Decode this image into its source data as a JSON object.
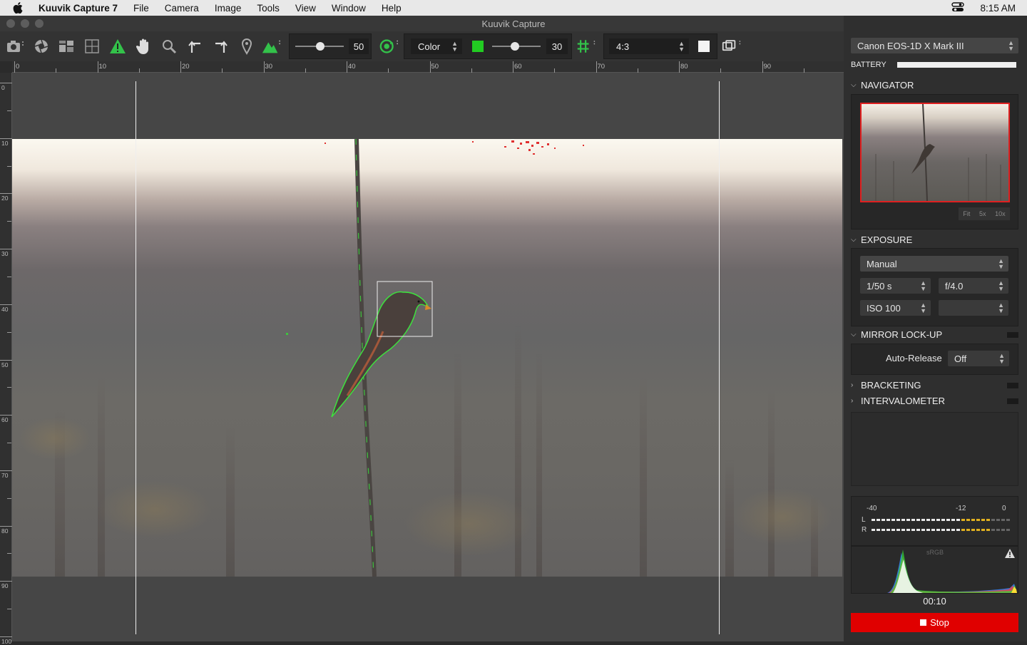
{
  "menubar": {
    "app_name": "Kuuvik Capture 7",
    "items": [
      "File",
      "Camera",
      "Image",
      "Tools",
      "View",
      "Window",
      "Help"
    ],
    "time": "8:15 AM"
  },
  "window": {
    "title": "Kuuvik Capture"
  },
  "toolbar": {
    "focus_value": "50",
    "overlay_mode": "Color",
    "overlay_color": "#22cc22",
    "overlay_value": "30",
    "aspect_ratio": "4:3"
  },
  "rulers": {
    "horizontal": [
      "0",
      "10",
      "20",
      "30",
      "40",
      "50",
      "60",
      "70",
      "80",
      "90"
    ],
    "vertical": [
      "0",
      "10",
      "20",
      "30",
      "40",
      "50",
      "60",
      "70",
      "80",
      "90",
      "100"
    ]
  },
  "sidebar": {
    "camera_model": "Canon EOS-1D X Mark III",
    "battery_label": "BATTERY",
    "battery_level": 1.0,
    "navigator": {
      "title": "NAVIGATOR",
      "zoom_fit": "Fit",
      "zoom_5x": "5x",
      "zoom_10x": "10x"
    },
    "exposure": {
      "title": "EXPOSURE",
      "mode": "Manual",
      "shutter": "1/50 s",
      "aperture": "f/4.0",
      "iso": "ISO 100",
      "extra": ""
    },
    "mirror_lockup": {
      "title": "MIRROR LOCK-UP",
      "auto_release_label": "Auto-Release",
      "auto_release_value": "Off"
    },
    "bracketing": {
      "title": "BRACKETING"
    },
    "intervalometer": {
      "title": "INTERVALOMETER"
    },
    "meter": {
      "scale_left": "-40",
      "scale_mid": "-12",
      "scale_right": "0",
      "channel_l": "L",
      "channel_r": "R"
    },
    "histogram": {
      "colorspace": "sRGB"
    },
    "timer": "00:10",
    "stop_label": "Stop"
  },
  "colors": {
    "accent_red": "#e00000",
    "overlay_green": "#22cc22"
  }
}
